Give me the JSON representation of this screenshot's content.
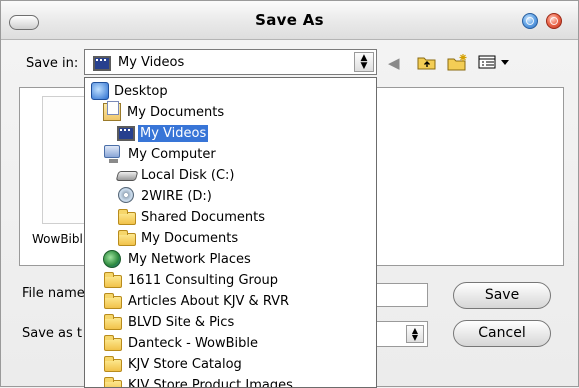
{
  "dialog": {
    "title": "Save As"
  },
  "save_in": {
    "label": "Save in:",
    "value": "My Videos"
  },
  "file_area": {
    "items": [
      {
        "label": "WowBibl"
      }
    ]
  },
  "file_name": {
    "label": "File name",
    "value": ""
  },
  "save_as_type": {
    "label": "Save as t",
    "value": ""
  },
  "buttons": {
    "save": "Save",
    "cancel": "Cancel"
  },
  "dropdown": {
    "items": [
      {
        "label": "Desktop",
        "icon": "desktop-icon",
        "indent": 0
      },
      {
        "label": "My Documents",
        "icon": "my-documents-icon",
        "indent": 1
      },
      {
        "label": "My Videos",
        "icon": "video-folder-icon",
        "indent": 2,
        "selected": true
      },
      {
        "label": "My Computer",
        "icon": "computer-icon",
        "indent": 1
      },
      {
        "label": "Local Disk (C:)",
        "icon": "hard-disk-icon",
        "indent": 2
      },
      {
        "label": "2WIRE (D:)",
        "icon": "cd-drive-icon",
        "indent": 2
      },
      {
        "label": "Shared Documents",
        "icon": "folder-icon",
        "indent": 2
      },
      {
        "label": "My Documents",
        "icon": "folder-icon",
        "indent": 2
      },
      {
        "label": "My Network Places",
        "icon": "network-icon",
        "indent": 1
      },
      {
        "label": "1611 Consulting Group",
        "icon": "folder-icon",
        "indent": 1
      },
      {
        "label": "Articles About KJV & RVR",
        "icon": "folder-icon",
        "indent": 1
      },
      {
        "label": "BLVD Site & Pics",
        "icon": "folder-icon",
        "indent": 1
      },
      {
        "label": "Danteck - WowBible",
        "icon": "folder-icon",
        "indent": 1
      },
      {
        "label": "KJV Store Catalog",
        "icon": "folder-icon",
        "indent": 1
      },
      {
        "label": "KJV Store Product Images",
        "icon": "folder-icon",
        "indent": 1
      }
    ]
  }
}
